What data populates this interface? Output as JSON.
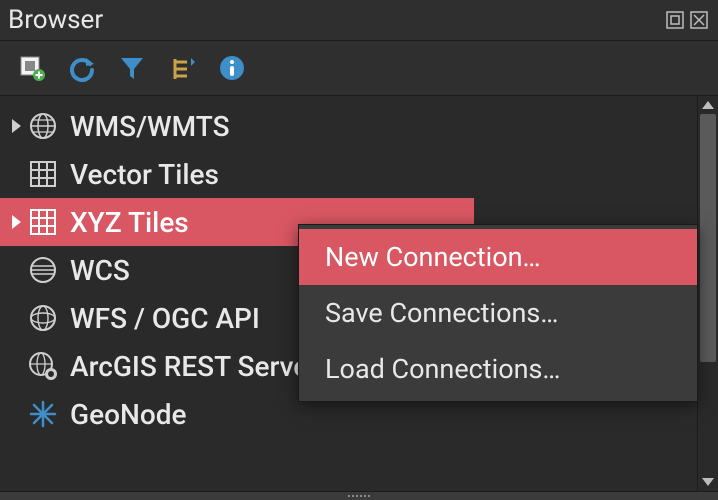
{
  "panel": {
    "title": "Browser"
  },
  "toolbar": {
    "icons": [
      "add-layer-icon",
      "refresh-icon",
      "filter-icon",
      "collapse-icon",
      "properties-icon"
    ]
  },
  "tree": {
    "items": [
      {
        "label": "WMS/WMTS",
        "icon": "globe-grid-icon",
        "expandable": true,
        "selected": false
      },
      {
        "label": "Vector Tiles",
        "icon": "grid-icon",
        "expandable": false,
        "selected": false
      },
      {
        "label": "XYZ Tiles",
        "icon": "grid-red-icon",
        "expandable": true,
        "selected": true
      },
      {
        "label": "WCS",
        "icon": "globe-lines-icon",
        "expandable": false,
        "selected": false
      },
      {
        "label": "WFS / OGC API",
        "icon": "globe-wire-icon",
        "expandable": false,
        "selected": false
      },
      {
        "label": "ArcGIS REST Servers",
        "icon": "globe-badge-icon",
        "expandable": false,
        "selected": false
      },
      {
        "label": "GeoNode",
        "icon": "snowflake-icon",
        "expandable": false,
        "selected": false
      }
    ]
  },
  "context_menu": {
    "items": [
      {
        "label": "New Connection…",
        "hover": true
      },
      {
        "label": "Save Connections…",
        "hover": false
      },
      {
        "label": "Load Connections…",
        "hover": false
      }
    ]
  }
}
